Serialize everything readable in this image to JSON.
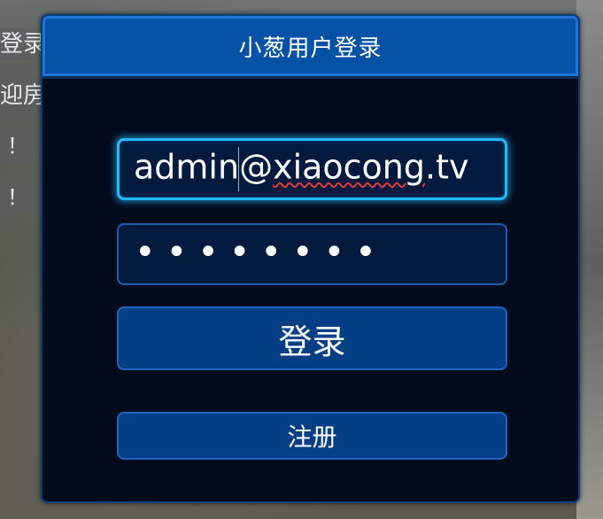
{
  "background": {
    "strip_1": "登录",
    "strip_2": "迎房",
    "strip_3": "！（",
    "strip_4": "！（"
  },
  "dialog": {
    "title": "小葱用户登录",
    "email": {
      "before_caret": "admin",
      "after_caret": "@",
      "misspelled": "xiaocong",
      "suffix": ".tv"
    },
    "password": {
      "masked": "••••••••"
    },
    "login_label": "登录",
    "register_label": "注册"
  },
  "colors": {
    "dialog_background": "#020b1c",
    "titlebar": "#0452a6",
    "field_focus_glow": "#25b8ff",
    "button": "#043f86",
    "spellcheck_underline": "#e23a3a"
  }
}
